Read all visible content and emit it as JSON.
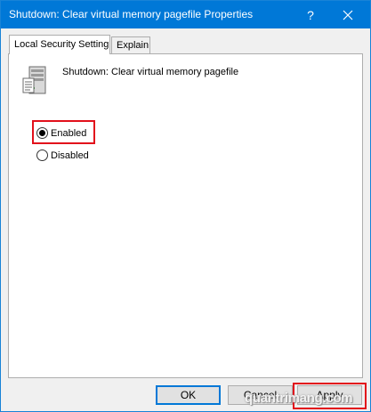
{
  "window": {
    "title": "Shutdown: Clear virtual memory pagefile Properties",
    "help_label": "?",
    "accent": "#0078d7"
  },
  "tabs": [
    {
      "label": "Local Security Setting",
      "active": true
    },
    {
      "label": "Explain",
      "active": false
    }
  ],
  "policy": {
    "icon": "server-policy-icon",
    "name": "Shutdown: Clear virtual memory pagefile"
  },
  "options": {
    "enabled_label": "Enabled",
    "disabled_label": "Disabled",
    "selected": "Enabled"
  },
  "buttons": {
    "ok": "OK",
    "cancel": "Cancel",
    "apply": "Apply"
  },
  "highlight_color": "#e2101b",
  "watermark": "quantrimang.com"
}
